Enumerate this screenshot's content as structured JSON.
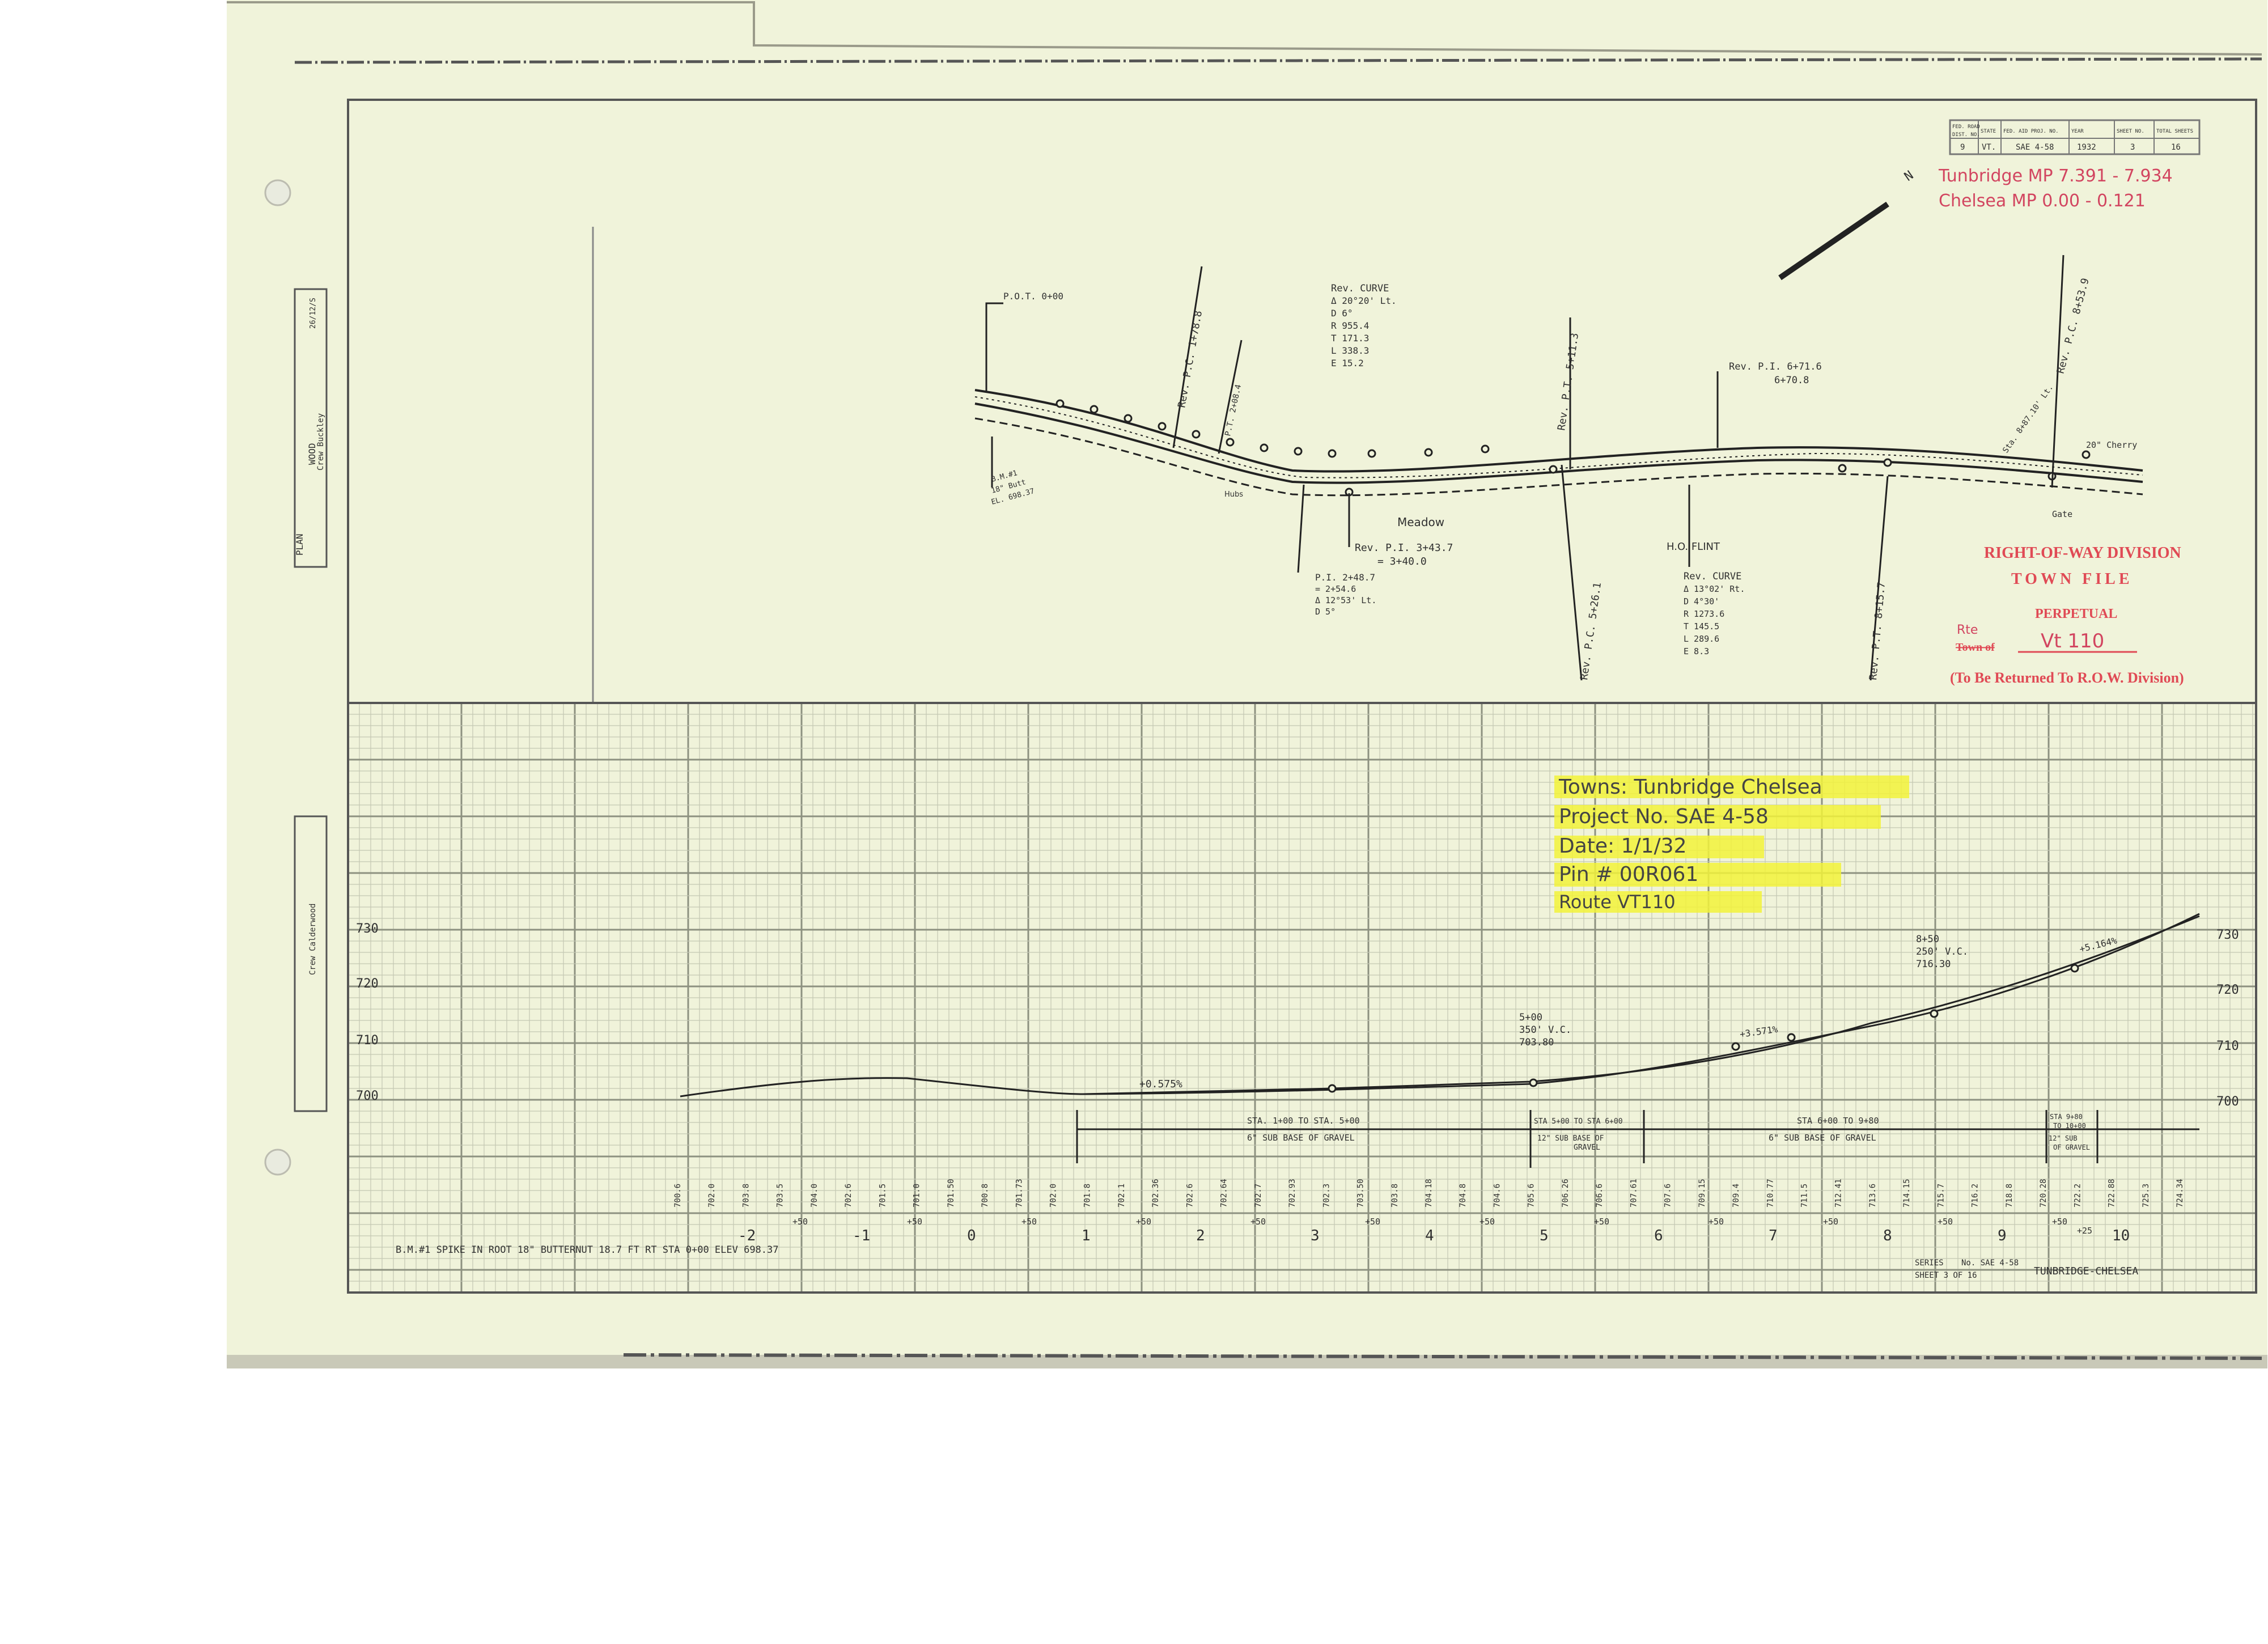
{
  "title_block": {
    "header": [
      "FED. ROAD",
      "DIST. NO.",
      "STATE",
      "FED. AID PROJ. NO.",
      "YEAR",
      "SHEET NO.",
      "TOTAL SHEETS"
    ],
    "values": [
      "9",
      "VT.",
      "SAE 4-58",
      "1932",
      "3",
      "16"
    ]
  },
  "mileposts": {
    "line1": "Tunbridge MP 7.391 - 7.934",
    "line2": "Chelsea MP 0.00 - 0.121"
  },
  "north_label": "N",
  "plan": {
    "pot": "P.O.T. 0+00",
    "rev_pc": "Rev. P.C. 1+78.8",
    "pt_label": "P.T. 2+08.4",
    "rev_curve_1": [
      "Rev. CURVE",
      "Δ 20°20' Lt.",
      "D 6°",
      "R 955.4",
      "T 171.3",
      "L 338.3",
      "E 15.2"
    ],
    "rev_pt_1": "Rev. P.T. 5+11.3",
    "rev_pi_2": [
      "Rev. P.I. 6+71.6",
      "6+70.8"
    ],
    "rev_pc_2": "Rev. P.C. 8+53.9",
    "sta_label": "Sta. 8+87.10' Lt.",
    "cherry": "20\" Cherry",
    "gate": "Gate",
    "meadow": "Meadow",
    "hubs": "Hubs",
    "rev_pi_mid": [
      "Rev. P.I. 3+43.7",
      "= 3+40.0"
    ],
    "pi_curve": [
      "P.I. 2+48.7",
      "= 2+54.6",
      "Δ 12°53' Lt.",
      "D 5°"
    ],
    "rev_pc_mid": "Rev. P.C. 5+26.1",
    "owner": "H.O. FLINT",
    "rev_curve_2": [
      "Rev. CURVE",
      "Δ 13°02' Rt.",
      "D 4°30'",
      "R 1273.6",
      "T 145.5",
      "L 289.6",
      "E 8.3"
    ],
    "rev_pt_2": "Rev. P.T. 8+15.7",
    "bm_label": [
      "B.M.#1",
      "18\" Butt",
      "EL. 698.37"
    ]
  },
  "row_stamp": {
    "line1": "RIGHT-OF-WAY DIVISION",
    "line2": "TOWN FILE",
    "line3": "PERPETUAL",
    "rte_label": "Rte",
    "town_of": "Town of",
    "route": "Vt 110",
    "returned": "(To Be Returned To R.O.W. Division)"
  },
  "sticker": {
    "towns": "Towns: Tunbridge Chelsea",
    "project": "Project No. SAE 4-58",
    "date": "Date: 1/1/32",
    "pin": "Pin # 00R061",
    "route": "Route VT110"
  },
  "profile": {
    "elev_labels": [
      "730",
      "720",
      "710",
      "700"
    ],
    "stations": [
      "-2",
      "-1",
      "0",
      "1",
      "2",
      "3",
      "4",
      "5",
      "6",
      "7",
      "8",
      "9",
      "10"
    ],
    "plus50": "+50",
    "plus25": "+25",
    "grade_1": "+0.575%",
    "grade_2": "+3.571%",
    "grade_3": "+5.164%",
    "vc1": [
      "5+00",
      "350' V.C.",
      "703.80"
    ],
    "vc2": [
      "8+50",
      "250' V.C.",
      "716.30"
    ],
    "base_1": [
      "STA. 1+00 TO STA. 5+00",
      "6\" SUB BASE OF GRAVEL"
    ],
    "base_2": [
      "STA 5+00 TO STA 6+00",
      "12\" SUB BASE OF",
      "GRAVEL"
    ],
    "base_3": [
      "STA 6+00 TO 9+80",
      "6\" SUB BASE OF GRAVEL"
    ],
    "base_4": [
      "STA 9+80",
      "TO 10+00",
      "12\" SUB",
      "OF GRAVEL"
    ],
    "elev_values": [
      "700.6",
      "702.0",
      "703.8",
      "703.5",
      "704.0",
      "702.6",
      "701.5",
      "701.0",
      "701.50",
      "700.8",
      "701.73",
      "702.0",
      "701.8",
      "702.1",
      "702.36",
      "702.6",
      "702.64",
      "702.7",
      "702.93",
      "702.3",
      "703.50",
      "703.8",
      "704.18",
      "704.8",
      "704.6",
      "705.6",
      "706.26",
      "706.6",
      "707.61",
      "707.6",
      "709.15",
      "709.4",
      "710.77",
      "711.5",
      "712.41",
      "713.6",
      "714.15",
      "715.7",
      "716.2",
      "718.8",
      "720.28",
      "722.2",
      "722.88",
      "725.3",
      "724.34"
    ],
    "footer_bm": "B.M.#1 SPIKE IN ROOT 18\" BUTTERNUT 18.7 FT RT STA 0+00 ELEV 698.37",
    "series": "SERIES",
    "series_no": "No. SAE 4-58",
    "sheet": "SHEET 3 OF 16",
    "town": "TUNBRIDGE-CHELSEA"
  },
  "margin": {
    "plan_label": "PLAN",
    "wood_label": "WOOD",
    "crew_label": "Crew Buckley",
    "code": "26/12/S",
    "prof_label": "Crew Calderwood"
  }
}
